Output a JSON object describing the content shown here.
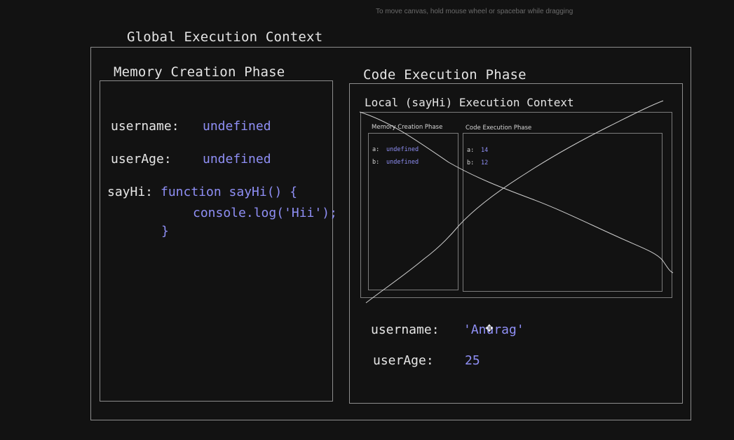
{
  "hint": "To move canvas, hold mouse wheel or spacebar while dragging",
  "global": {
    "title": "Global Execution Context",
    "memory": {
      "title": "Memory Creation Phase",
      "username_label": "username:",
      "username_value": "undefined",
      "userage_label": "userAge:",
      "userage_value": "undefined",
      "sayhi_label": "sayHi:",
      "sayhi_line1": "function sayHi() {",
      "sayhi_line2": "console.log('Hii');",
      "sayhi_line3": "}"
    },
    "code": {
      "title": "Code Execution Phase",
      "username_label": "username:",
      "username_value": "'Anurag'",
      "userage_label": "userAge:",
      "userage_value": "25"
    }
  },
  "local": {
    "title": "Local (sayHi) Execution Context",
    "memory": {
      "title": "Memory Creation Phase",
      "a_label": "a:",
      "a_value": "undefined",
      "b_label": "b:",
      "b_value": "undefined"
    },
    "code": {
      "title": "Code Execution Phase",
      "a_label": "a:",
      "a_value": "14",
      "b_label": "b:",
      "b_value": "12"
    }
  },
  "colors": {
    "background": "#121212",
    "text": "#e6e6e6",
    "value": "#8f8ff5",
    "border": "#8d8d8d"
  }
}
